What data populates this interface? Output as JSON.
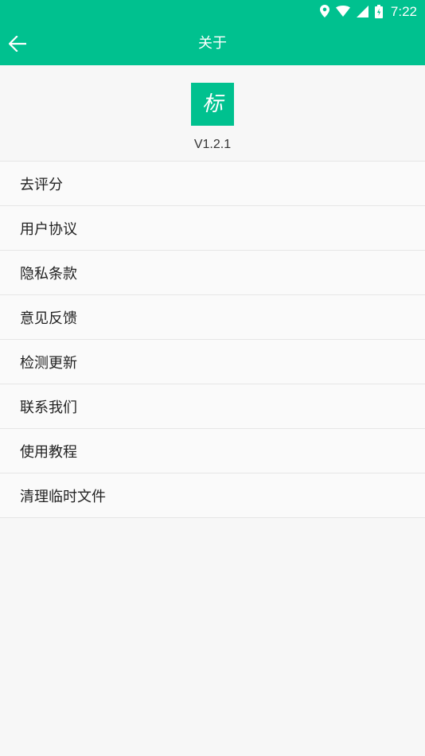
{
  "status_bar": {
    "time": "7:22",
    "icons": [
      "location-icon",
      "wifi-icon",
      "signal-icon",
      "battery-icon"
    ]
  },
  "app_bar": {
    "title": "关于",
    "back_icon": "back-arrow-icon"
  },
  "header": {
    "logo_char": "标",
    "version": "V1.2.1"
  },
  "menu": [
    {
      "label": "去评分"
    },
    {
      "label": "用户协议"
    },
    {
      "label": "隐私条款"
    },
    {
      "label": "意见反馈"
    },
    {
      "label": "检测更新"
    },
    {
      "label": "联系我们"
    },
    {
      "label": "使用教程"
    },
    {
      "label": "清理临时文件"
    }
  ],
  "colors": {
    "accent": "#00c18f",
    "background": "#f7f7f7",
    "divider": "#e6e6e6"
  }
}
